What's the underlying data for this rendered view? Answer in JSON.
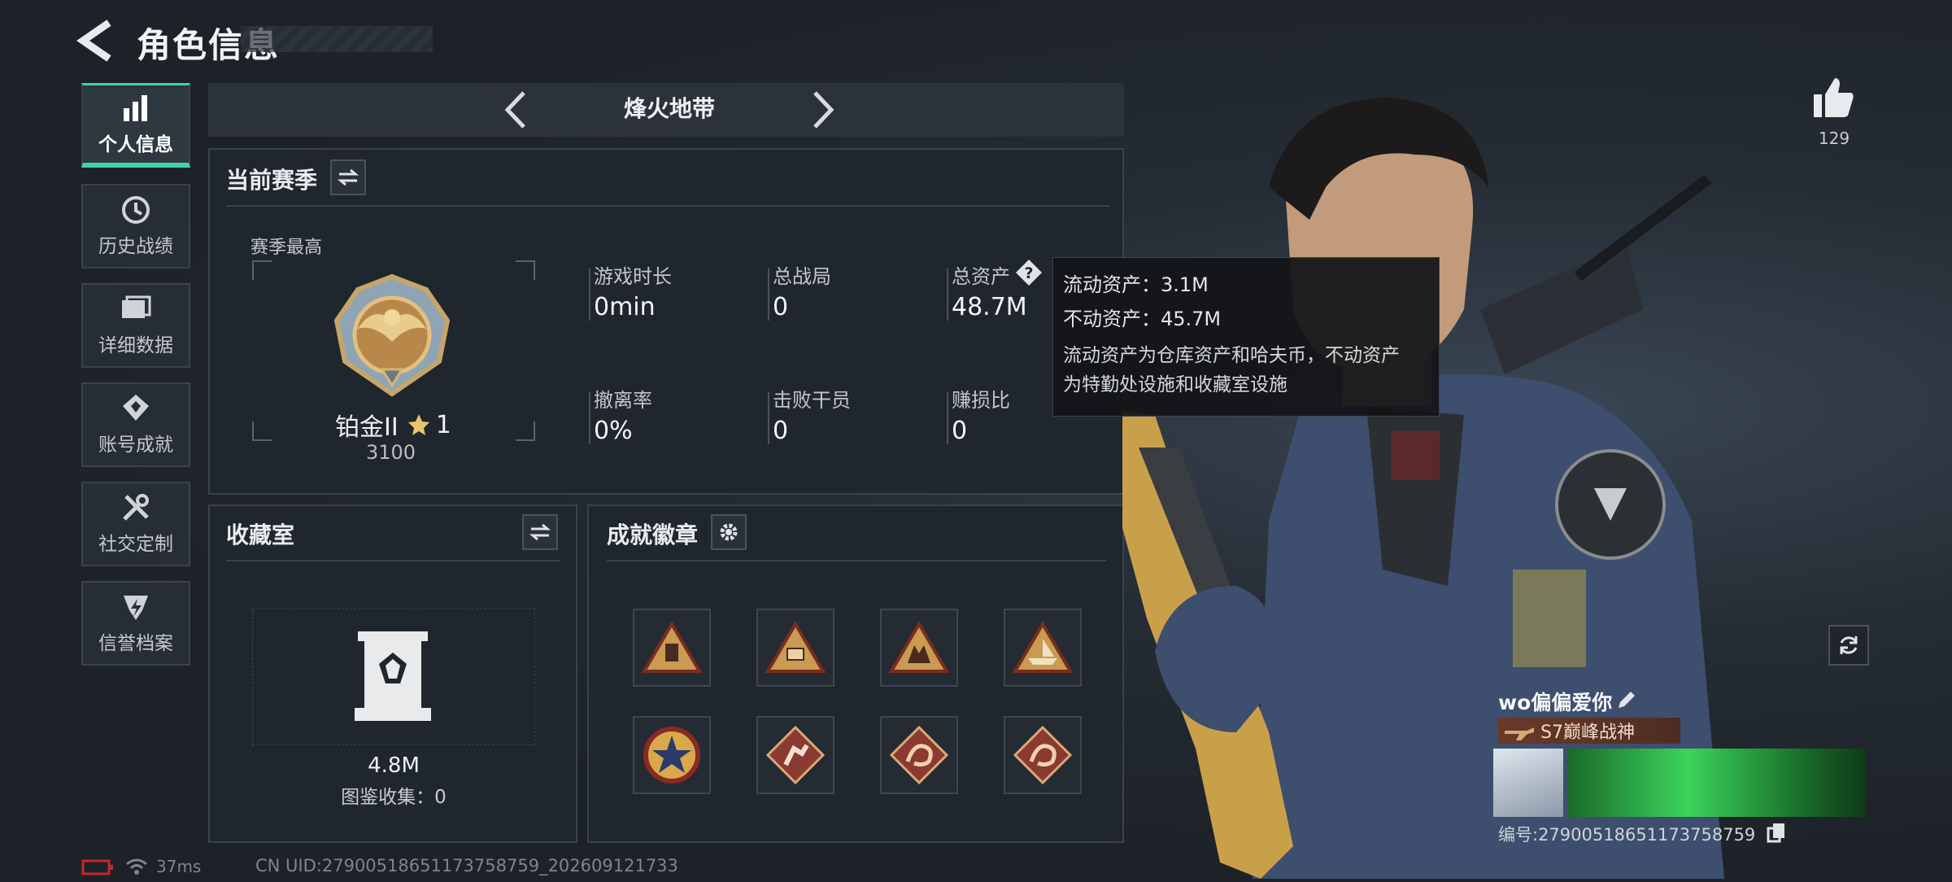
{
  "header": {
    "title": "角色信息"
  },
  "nav": {
    "items": [
      {
        "label": "个人信息",
        "icon": "bar-chart-icon",
        "active": true
      },
      {
        "label": "历史战绩",
        "icon": "history-icon",
        "active": false
      },
      {
        "label": "详细数据",
        "icon": "folder-icon",
        "active": false
      },
      {
        "label": "账号成就",
        "icon": "achievement-icon",
        "active": false
      },
      {
        "label": "社交定制",
        "icon": "tools-icon",
        "active": false
      },
      {
        "label": "信誉档案",
        "icon": "shield-icon",
        "active": false
      }
    ]
  },
  "mode": {
    "name": "烽火地带"
  },
  "season": {
    "title": "当前赛季",
    "peak_label": "赛季最高",
    "rank_name": "铂金II",
    "rank_stars": "1",
    "rank_score": "3100",
    "stats": [
      {
        "label": "游戏时长",
        "value": "0min"
      },
      {
        "label": "总战局",
        "value": "0"
      },
      {
        "label": "总资产",
        "value": "48.7M"
      },
      {
        "label": "撤离率",
        "value": "0%"
      },
      {
        "label": "击败干员",
        "value": "0"
      },
      {
        "label": "赚损比",
        "value": "0"
      }
    ]
  },
  "tooltip": {
    "liquid": "流动资产：3.1M",
    "fixed": "不动资产：45.7M",
    "desc_line1": "流动资产为仓库资产和哈夫币，不动资产",
    "desc_line2": "为特勤处设施和收藏室设施"
  },
  "collection": {
    "title": "收藏室",
    "value": "4.8M",
    "catalog": "图鉴收集：0"
  },
  "badges": {
    "title": "成就徽章",
    "items": [
      "badge-triangle-robot-icon",
      "badge-triangle-58-icon",
      "badge-triangle-soldiers-icon",
      "badge-triangle-boat-icon",
      "badge-round-star-icon",
      "badge-diamond-runner-icon",
      "badge-diamond-dragon-icon",
      "badge-diamond-dragon-icon"
    ]
  },
  "profile": {
    "likes": "129",
    "name": "wo偏偏爱你",
    "title": "S7巅峰战神",
    "id_text": "编号:27900518651173758759"
  },
  "status": {
    "ping": "37ms",
    "uid": "CN UID:27900518651173758759_202609121733"
  },
  "colors": {
    "accent": "#3fd4a8",
    "panel": "#20262d",
    "border": "#3a434c"
  }
}
